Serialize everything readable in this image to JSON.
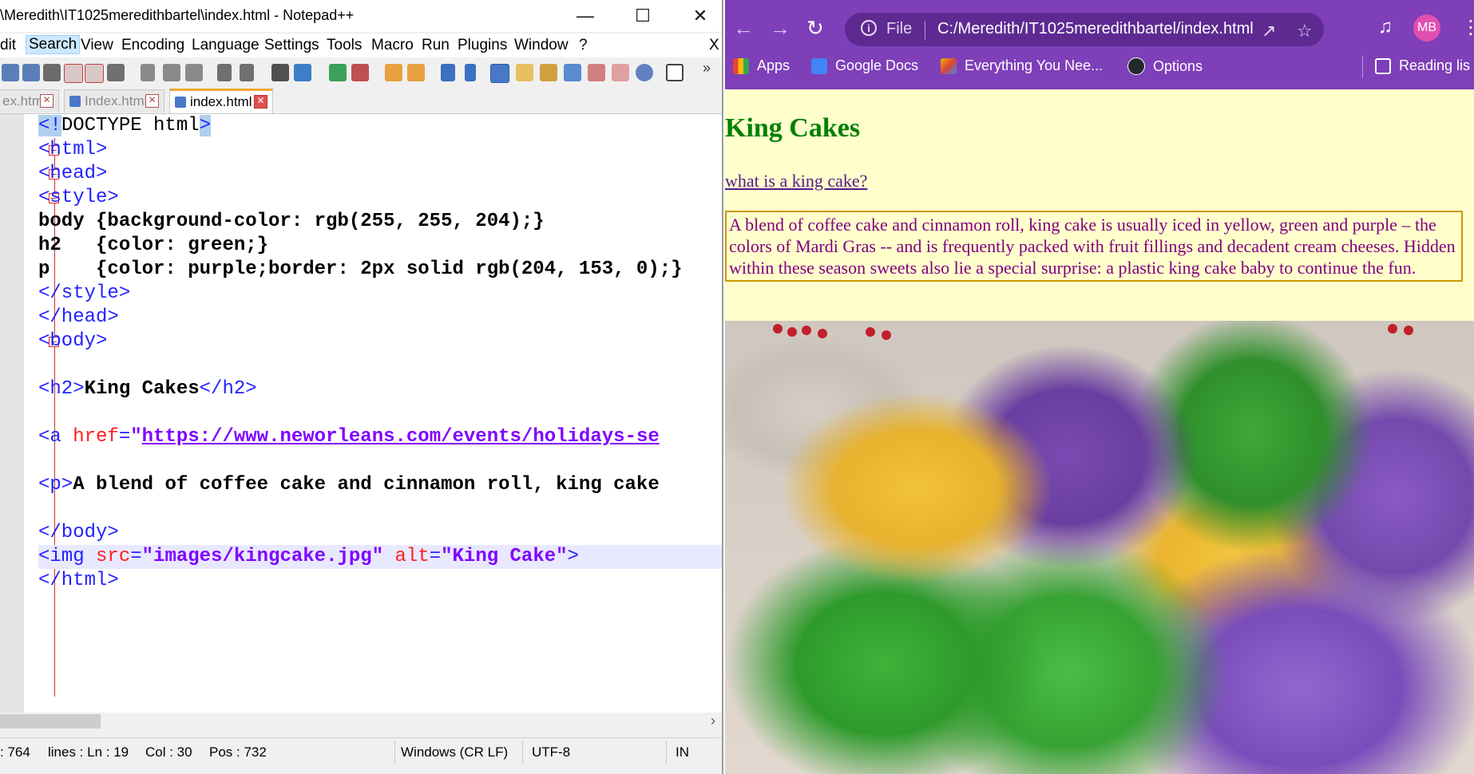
{
  "notepad": {
    "title": "\\Meredith\\IT1025meredithbartel\\index.html - Notepad++",
    "menu": [
      "dit",
      "Search",
      "View",
      "Encoding",
      "Language",
      "Settings",
      "Tools",
      "Macro",
      "Run",
      "Plugins",
      "Window",
      "?",
      "X"
    ],
    "tabs": [
      "ex.html",
      "Index.html",
      "index.html"
    ],
    "code_lines": [
      "<!DOCTYPE html>",
      "<html>",
      "<head>",
      "<style>",
      "body {background-color: rgb(255, 255, 204);}",
      "h2   {color: green;}",
      "p    {color: purple;border: 2px solid rgb(204, 153, 0);}",
      "</style>",
      "</head>",
      "<body>",
      "",
      "<h2>King Cakes</h2>",
      "",
      "<a href=\"https://www.neworleans.com/events/holidays-se",
      "",
      "<p>A blend of coffee cake and cinnamon roll, king cake",
      "",
      "</body>",
      "<img src=\"images/kingcake.jpg\" alt=\"King Cake\">",
      "</html>"
    ],
    "status": {
      "length": ": 764",
      "lines": "lines : Ln : 19",
      "col": "Col : 30",
      "pos": "Pos : 732",
      "eol": "Windows (CR LF)",
      "encoding": "UTF-8",
      "mode": "IN"
    }
  },
  "chrome": {
    "omnibox": {
      "scheme_label": "File",
      "url": "C:/Meredith/IT1025meredithbartel/index.html"
    },
    "avatar": "MB",
    "bookmarks": [
      "Apps",
      "Google Docs",
      "Everything You Nee...",
      "Options",
      "Reading lis"
    ],
    "page": {
      "heading": "King Cakes",
      "link": "what is a king cake?",
      "paragraph": "A blend of coffee cake and cinnamon roll, king cake is usually iced in yellow, green and purple – the colors of Mardi Gras -- and is frequently packed with fruit fillings and decadent cream cheeses. Hidden within these season sweets also lie a special surprise: a plastic king cake baby to continue the fun.",
      "image_alt": "King Cake"
    }
  },
  "colors": {
    "page_background": "#ffffcc",
    "heading": "#008000",
    "paragraph": "#800080",
    "border": "#cc9900",
    "chrome_frame": "#7e3fb8"
  }
}
